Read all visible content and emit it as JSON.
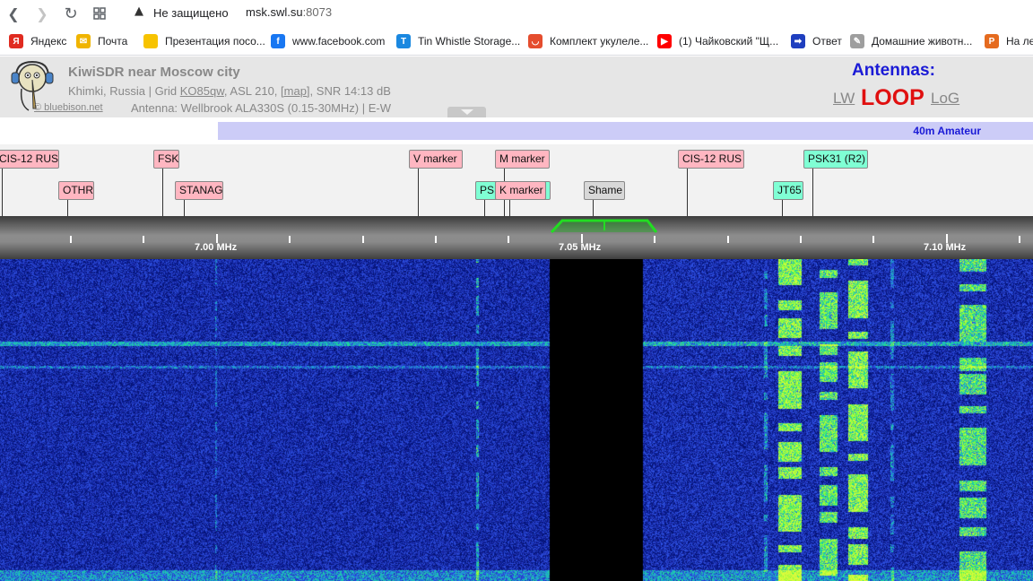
{
  "browser": {
    "security_label": "Не защищено",
    "url_host": "msk.swl.su",
    "url_port": ":8073",
    "bookmarks": [
      {
        "label": "Яндекс",
        "icon": "yandex-icon",
        "color": "#e02b20",
        "glyph": "Я"
      },
      {
        "label": "Почта",
        "icon": "mail-icon",
        "color": "#f0b400",
        "glyph": "✉"
      },
      {
        "label": "Презентация посо...",
        "icon": "slides-icon",
        "color": "#f7c300",
        "glyph": ""
      },
      {
        "label": "www.facebook.com",
        "icon": "facebook-icon",
        "color": "#1877f2",
        "glyph": "f"
      },
      {
        "label": "Tin Whistle Storage...",
        "icon": "tinwhistle-icon",
        "color": "#1a88e0",
        "glyph": "T"
      },
      {
        "label": "Комплект укулеле...",
        "icon": "shop-icon",
        "color": "#e54d2e",
        "glyph": "◡"
      },
      {
        "label": "(1) Чайковский \"Щ...",
        "icon": "youtube-icon",
        "color": "#ff0000",
        "glyph": "▶"
      },
      {
        "label": "Ответ",
        "icon": "arrow-icon",
        "color": "#1f3fbf",
        "glyph": "➡"
      },
      {
        "label": "Домашние животн...",
        "icon": "notepad-icon",
        "color": "#9e9e9e",
        "glyph": "✎"
      },
      {
        "label": "На ле",
        "icon": "bookmark-icon",
        "color": "#e56b1f",
        "glyph": "P"
      }
    ]
  },
  "header": {
    "title": "KiwiSDR near Moscow city",
    "location_prefix": "Khimki, Russia | Grid ",
    "grid": "KO85qw",
    "asl": ", ASL 210, ",
    "map_link": "[map]",
    "snr": ", SNR 14:13 dB",
    "copyright": "© bluebison.net",
    "antenna": "Antenna: Wellbrook ALA330S (0.15-30MHz) | E-W"
  },
  "antennas": {
    "title": "Antennas:",
    "lw": "LW",
    "loop": "LOOP",
    "log": "LoG"
  },
  "band": {
    "name": "40m Amateur"
  },
  "markers": [
    {
      "label": "CIS-12 RUS",
      "row": 0,
      "style": "pink"
    },
    {
      "label": "FSK",
      "row": 0,
      "style": "pink"
    },
    {
      "label": "V marker",
      "row": 0,
      "style": "pink"
    },
    {
      "label": "M marker",
      "row": 0,
      "style": "pink"
    },
    {
      "label": "CIS-12 RUS",
      "row": 0,
      "style": "pink"
    },
    {
      "label": "PSK31 (R2)",
      "row": 0,
      "style": "aqua"
    },
    {
      "label": "OTHR",
      "row": 1,
      "style": "pink"
    },
    {
      "label": "STANAG",
      "row": 1,
      "style": "pink"
    },
    {
      "label": "PSK31",
      "row": 1,
      "style": "aqua"
    },
    {
      "label": "K marker",
      "row": 1,
      "style": "pink"
    },
    {
      "label": "Shame",
      "row": 1,
      "style": "gray"
    },
    {
      "label": "JT65",
      "row": 1,
      "style": "aqua"
    }
  ],
  "scale": {
    "labels": [
      "7.00 MHz",
      "7.05 MHz",
      "7.10 MHz"
    ],
    "passband_color": "#22dd22"
  },
  "waterfall": {
    "background_color": "#16209a",
    "blank_band_color": "#000000"
  }
}
